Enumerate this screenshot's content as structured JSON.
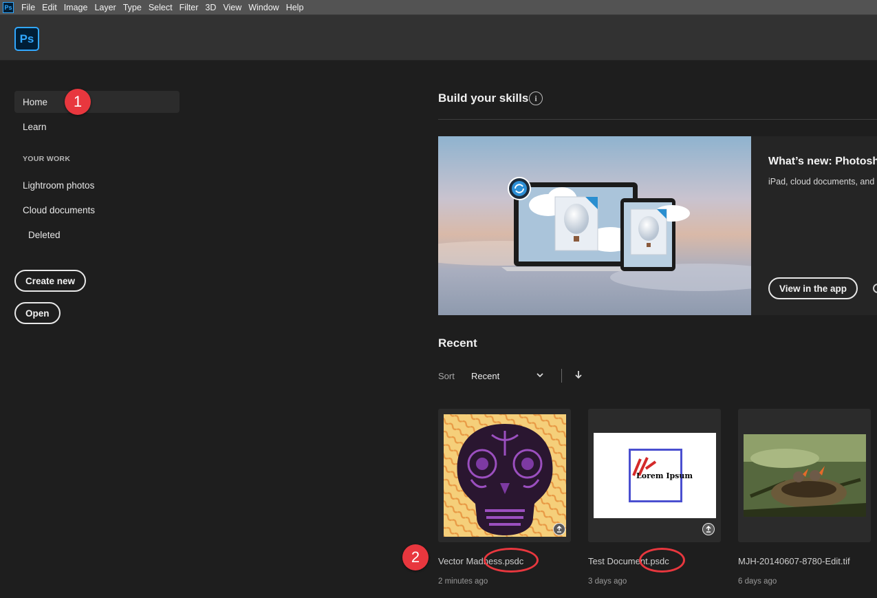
{
  "menubar": {
    "app_icon": "Ps",
    "items": [
      "File",
      "Edit",
      "Image",
      "Layer",
      "Type",
      "Select",
      "Filter",
      "3D",
      "View",
      "Window",
      "Help"
    ]
  },
  "header": {
    "logo": "Ps"
  },
  "sidebar": {
    "home": "Home",
    "learn": "Learn",
    "section": "YOUR WORK",
    "lightroom": "Lightroom photos",
    "cloud_docs": "Cloud documents",
    "deleted": "Deleted",
    "create_new": "Create new",
    "open": "Open"
  },
  "callouts": {
    "one": "1",
    "two": "2"
  },
  "skills": {
    "title": "Build your skills",
    "info_icon": "i",
    "banner_title": "What’s new: Photosh",
    "banner_sub": "iPad, cloud documents, and",
    "banner_button": "View in the app"
  },
  "recent": {
    "title": "Recent",
    "sort_label": "Sort",
    "sort_value": "Recent",
    "files": [
      {
        "name": "Vector Madness.psdc",
        "time": "2 minutes ago"
      },
      {
        "name": "Test Document.psdc",
        "time": "3 days ago",
        "thumb_text": "Lorem Ipsum"
      },
      {
        "name": "MJH-20140607-8780-Edit.tif",
        "time": "6 days ago"
      }
    ]
  },
  "colors": {
    "accent": "#31a8ff",
    "callout": "#e8373e",
    "background": "#1e1e1e"
  }
}
